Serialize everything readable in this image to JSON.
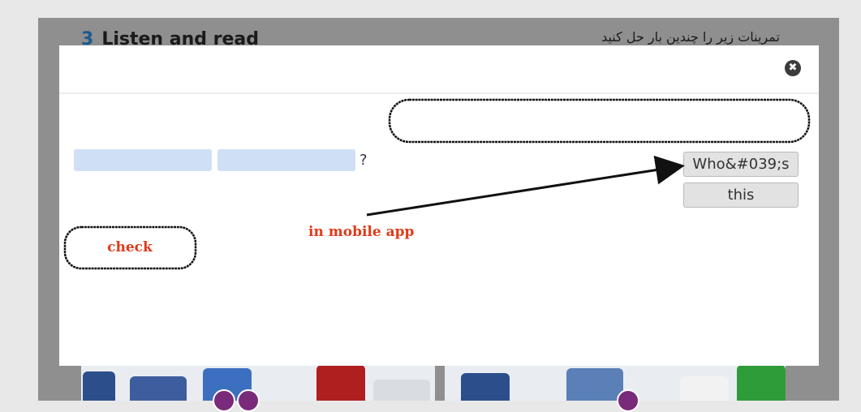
{
  "background": {
    "exercise_number": "3",
    "exercise_title": "Listen and read",
    "instruction_fa": "تمرینات زیر را چندین بار حل کنید"
  },
  "modal": {
    "close_glyph": "✖",
    "question_mark": "?",
    "word_tiles": [
      "Who&#039;s",
      "this"
    ],
    "check_label": "check",
    "annotation": "in mobile app"
  },
  "colors": {
    "overlay": "#8f8f8f",
    "slot_fill": "#cfe0f5",
    "tile_fill": "#e2e2e2",
    "annotation_red": "#e03a1a"
  }
}
